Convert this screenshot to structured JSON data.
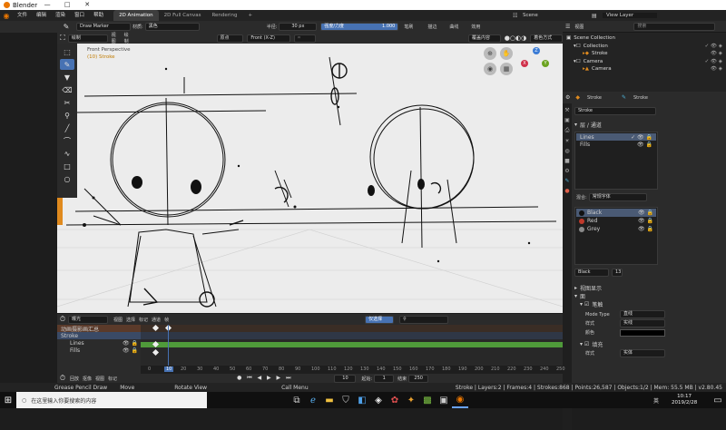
{
  "window": {
    "title": "Blender",
    "min": "—",
    "max": "□",
    "close": "✕"
  },
  "menu": {
    "items": [
      "文件",
      "编辑",
      "渲染",
      "窗口",
      "帮助"
    ],
    "tabs": [
      "2D Animation",
      "2D Full Canvas",
      "Rendering"
    ],
    "add_tab": "+",
    "scene": "Scene",
    "view_layer": "View Layer"
  },
  "tool_header": {
    "tool": "Draw Marker",
    "material_label": "材质:",
    "material": "黑色",
    "radius_label": "半径:",
    "radius": "30 px",
    "strength_label": "强度/力度",
    "strength": "1.000",
    "advanced": "笔刷",
    "stroke": "描边",
    "curve": "曲线",
    "more": "效用"
  },
  "viewport_header": {
    "mode": "绘制",
    "view": "视图",
    "draw": "绘制",
    "origin": "原点",
    "front": "Front (X-Z)",
    "overlay": "覆盖内容",
    "shading": "着色方式",
    "perspective": "Front Perspective",
    "object": "(10) Stroke",
    "axis_z": "Z",
    "axis_x": "X",
    "axis_y": "Y"
  },
  "outliner": {
    "header": "视图",
    "search": "搜索",
    "collection_root": "Scene Collection",
    "items": [
      {
        "label": "Collection",
        "level": 1
      },
      {
        "label": "Stroke",
        "level": 2
      },
      {
        "label": "Camera",
        "level": 1
      },
      {
        "label": "Camera",
        "level": 2
      }
    ]
  },
  "properties": {
    "object": "Stroke",
    "data": "Stroke",
    "datablock": "Stroke",
    "layers_title": "层 / 通道",
    "layers": [
      {
        "name": "Lines",
        "selected": true
      },
      {
        "name": "Fills",
        "selected": false
      }
    ],
    "blend_label": "混合:",
    "blend": "常规字体",
    "materials": [
      {
        "name": "Black",
        "color": "#111111"
      },
      {
        "name": "Red",
        "color": "#c0392b"
      },
      {
        "name": "Grey",
        "color": "#8a8a8a"
      }
    ],
    "slot": "Black",
    "slot_count": "13",
    "viewport_display": "视图显示",
    "surface": "面",
    "stroke_section": "笔触",
    "mode_type_label": "Mode Type",
    "mode_type": "直线",
    "style_label": "样式",
    "style": "实线",
    "color_label": "颜色",
    "fill_section": "填充",
    "fill_style": "实体"
  },
  "timeline": {
    "mode": "曝光",
    "menus": [
      "视图",
      "选择",
      "标记",
      "通道",
      "帧"
    ],
    "only_selected": "仅选择",
    "channels": [
      "动画摄影画汇总",
      "Stroke",
      "Lines",
      "Fills"
    ],
    "ruler": [
      "0",
      "10",
      "20",
      "30",
      "40",
      "50",
      "60",
      "70",
      "80",
      "90",
      "100",
      "110",
      "120",
      "130",
      "140",
      "150",
      "160",
      "170",
      "180",
      "190",
      "200",
      "210",
      "220",
      "230",
      "240",
      "250"
    ],
    "current_frame": "10"
  },
  "playback": {
    "menus": [
      "回放",
      "抠像",
      "视图",
      "标记"
    ],
    "frame": "10",
    "start_label": "起始:",
    "start": "1",
    "end_label": "结束",
    "end": "250"
  },
  "status": {
    "left": [
      "Grease Pencil Draw",
      "Move",
      "Rotate View",
      "Call Menu"
    ],
    "right": "Stroke | Layers:2 | Frames:4 | Strokes:868 | Points:26,587 | Objects:1/2 | Mem: 55.5 MB | v2.80.45"
  },
  "taskbar": {
    "search": "在这里输入你要搜索的内容",
    "time": "10:17",
    "date": "2019/2/28",
    "lang": "英"
  },
  "colors": {
    "accent": "#4772b3",
    "timeline_green": "#4f9a3a",
    "header": "#2b2b2b",
    "orange": "#ea7600"
  }
}
